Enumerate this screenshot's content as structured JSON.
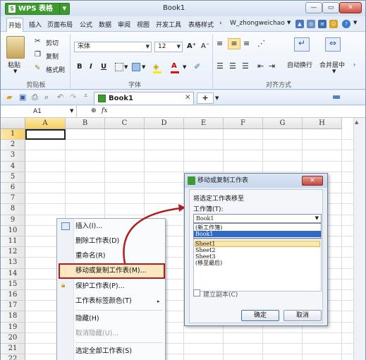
{
  "window": {
    "app_name": "WPS 表格",
    "title": "Book1",
    "s_glyph": "S"
  },
  "menu_tabs": [
    "开始",
    "插入",
    "页面布局",
    "公式",
    "数据",
    "审阅",
    "视图",
    "开发工具",
    "表格样式"
  ],
  "user": "W_zhongweichao",
  "ribbon": {
    "clipboard": {
      "paste": "粘贴",
      "cut": "剪切",
      "copy": "复制",
      "format_painter": "格式刷",
      "label": "剪贴板"
    },
    "font": {
      "name": "宋体",
      "size": "12",
      "bold": "B",
      "italic": "I",
      "underline": "U",
      "grow": "A⁺",
      "shrink": "A⁻",
      "label": "字体"
    },
    "align": {
      "wrap": "自动换行",
      "merge": "合并居中",
      "label": "对齐方式"
    }
  },
  "doc_tab": {
    "name": "Book1"
  },
  "formula_bar": {
    "cell_ref": "A1",
    "fx": "fx"
  },
  "grid": {
    "columns": [
      "A",
      "B",
      "C",
      "D",
      "E",
      "F",
      "G",
      "H"
    ],
    "rows": [
      "1",
      "2",
      "3",
      "4",
      "5",
      "6",
      "7",
      "8",
      "9",
      "10",
      "11",
      "12",
      "13",
      "14",
      "15",
      "16",
      "17",
      "18",
      "19",
      "20",
      "21",
      "22"
    ]
  },
  "context_menu": {
    "items": [
      {
        "label": "插入(I)...",
        "disabled": false
      },
      {
        "label": "删除工作表(D)",
        "disabled": false
      },
      {
        "label": "重命名(R)",
        "disabled": false
      },
      {
        "label": "移动或复制工作表(M)...",
        "disabled": false,
        "highlighted": true
      },
      {
        "label": "保护工作表(P)...",
        "disabled": false
      },
      {
        "label": "工作表标签颜色(T)",
        "disabled": false
      },
      {
        "label": "隐藏(H)",
        "disabled": false
      },
      {
        "label": "取消隐藏(U)...",
        "disabled": true
      },
      {
        "label": "选定全部工作表(S)",
        "disabled": false
      }
    ]
  },
  "dialog": {
    "title": "移动或复制工作表",
    "close": "✕",
    "prompt": "将选定工作表移至",
    "workbook_label": "工作簿(T):",
    "workbook_selected": "Book1",
    "workbook_options": [
      "(新工作簿)",
      "Book1"
    ],
    "sheets": [
      "Sheet1",
      "Sheet2",
      "Sheet3",
      "(移至最后)"
    ],
    "copy_checkbox": "建立副本(C)",
    "ok": "确定",
    "cancel": "取消"
  },
  "colors": {
    "highlight_border": "#b11c1c",
    "arrow": "#b11c1c",
    "selection": "#3169c6"
  }
}
